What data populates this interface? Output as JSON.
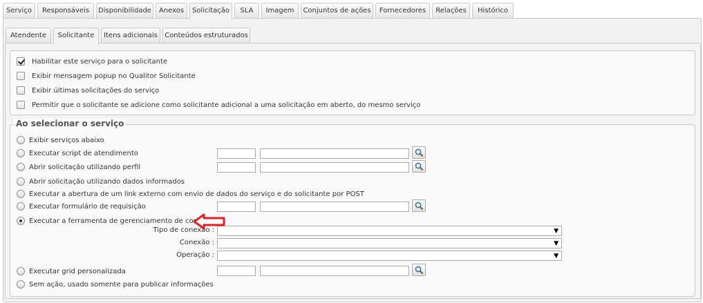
{
  "top_tabs": [
    "Serviço",
    "Responsáveis",
    "Disponibilidade",
    "Anexos",
    "Solicitação",
    "SLA",
    "Imagem",
    "Conjuntos de ações",
    "Fornecedores",
    "Relações",
    "Histórico"
  ],
  "top_tab_active": "Solicitação",
  "sub_tabs": [
    "Atendente",
    "Solicitante",
    "Itens adicionais",
    "Conteúdos estruturados"
  ],
  "sub_tab_active": "Solicitante",
  "checkboxes": [
    {
      "label": "Habilitar este serviço para o solicitante",
      "checked": true
    },
    {
      "label": "Exibir mensagem popup no Qualitor Solicitante",
      "checked": false
    },
    {
      "label": "Exibir últimas solicitações do serviço",
      "checked": false
    },
    {
      "label": "Permitir que o solicitante se adicione como solicitante adicional a uma solicitação em aberto, do mesmo serviço",
      "checked": false
    }
  ],
  "fieldset_title": "Ao selecionar o serviço",
  "radios": [
    {
      "label": "Exibir serviços abaixo",
      "checked": false
    },
    {
      "label": "Executar script de atendimento",
      "checked": false
    },
    {
      "label": "Abrir solicitação utilizando perfil",
      "checked": false
    },
    {
      "label": "Abrir solicitação utilizando dados informados",
      "checked": false
    },
    {
      "label": "Executar a abertura de um link externo com envio de dados do serviço e do solicitante por POST",
      "checked": false
    },
    {
      "label": "Executar formulário de requisição",
      "checked": false
    },
    {
      "label": "Executar a ferramenta de gerenciamento de contas",
      "checked": true
    },
    {
      "label": "Executar grid personalizada",
      "checked": false
    },
    {
      "label": "Sem ação, usado somente para publicar informações",
      "checked": false
    }
  ],
  "account_tool_fields": [
    {
      "label": "Tipo de conexão :",
      "value": ""
    },
    {
      "label": "Conexão :",
      "value": ""
    },
    {
      "label": "Operação :",
      "value": ""
    }
  ],
  "colors": {
    "arrow": "#e02020",
    "panel_bg": "#f4f4f4",
    "border": "#c9c9c9"
  },
  "icons": {
    "lookup": "magnifier-icon",
    "select_caret": "caret-down-icon",
    "annotation": "arrow-left-icon"
  }
}
